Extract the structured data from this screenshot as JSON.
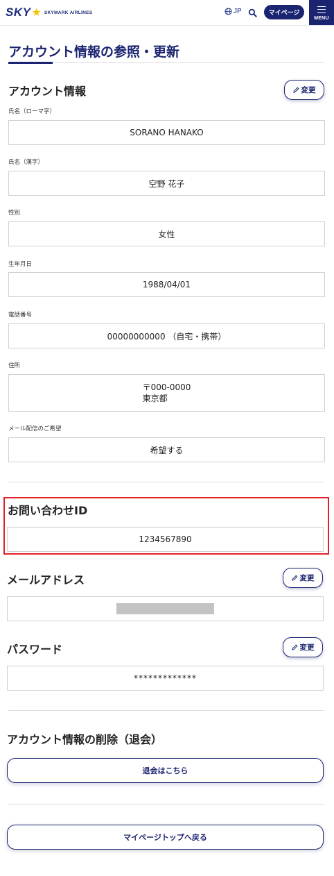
{
  "header": {
    "logo_sky": "SKY",
    "logo_star": "★",
    "logo_name": "SKYMARK AIRLINES",
    "lang_label": "JP",
    "mypage_label": "マイページ",
    "menu_label": "MENU"
  },
  "page_title": "アカウント情報の参照・更新",
  "account": {
    "section_title": "アカウント情報",
    "edit_label": "変更",
    "fields": [
      {
        "label": "氏名（ローマ字）",
        "value": "SORANO HANAKO"
      },
      {
        "label": "氏名（漢字）",
        "value": "空野 花子"
      },
      {
        "label": "性別",
        "value": "女性"
      },
      {
        "label": "生年月日",
        "value": "1988/04/01"
      },
      {
        "label": "電話番号",
        "value": "00000000000 （自宅・携帯）"
      },
      {
        "label": "住所",
        "value": "〒000-0000",
        "value2": "東京都"
      },
      {
        "label": "メール配信のご希望",
        "value": "希望する"
      }
    ]
  },
  "inquiry": {
    "section_title": "お問い合わせID",
    "value": "1234567890"
  },
  "email": {
    "section_title": "メールアドレス",
    "edit_label": "変更"
  },
  "password": {
    "section_title": "パスワード",
    "edit_label": "変更",
    "value": "*************"
  },
  "delete": {
    "section_title": "アカウント情報の削除（退会）",
    "button_label": "退会はこちら"
  },
  "back_button_label": "マイページトップへ戻る",
  "colors": {
    "brand": "#1b2470",
    "highlight": "#e21f26",
    "star": "#f5c400"
  }
}
